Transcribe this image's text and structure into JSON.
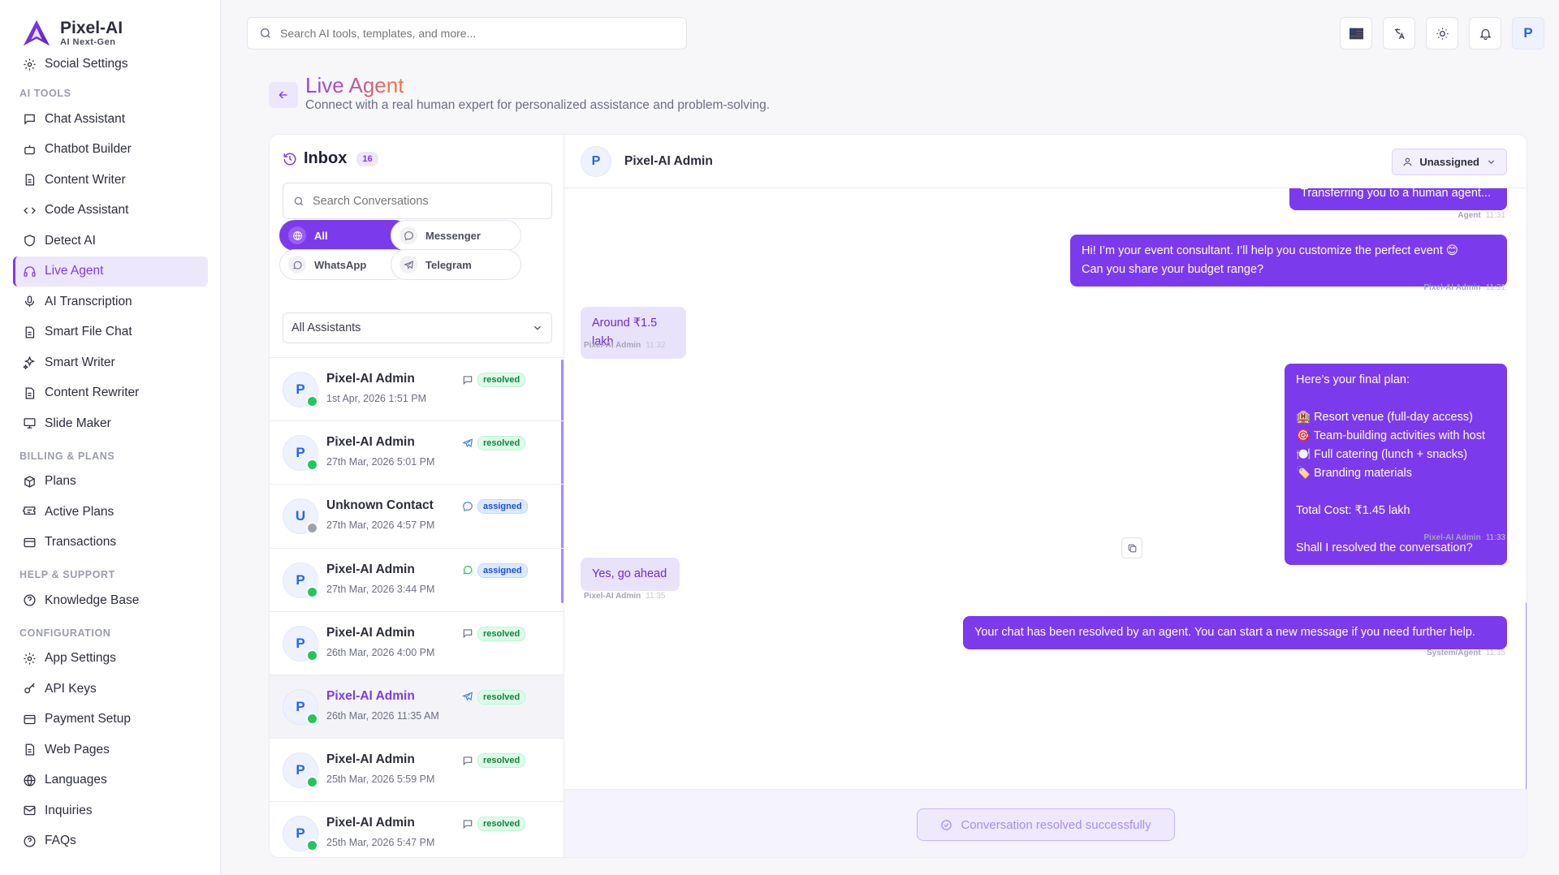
{
  "brand": {
    "name": "Pixel-AI",
    "tagline": "AI Next-Gen"
  },
  "sidebar": {
    "first_item": "Social Settings",
    "sections": [
      {
        "title": "AI TOOLS",
        "items": [
          {
            "label": "Chat Assistant",
            "icon": "chat-icon"
          },
          {
            "label": "Chatbot Builder",
            "icon": "bot-icon"
          },
          {
            "label": "Content Writer",
            "icon": "doc-icon"
          },
          {
            "label": "Code Assistant",
            "icon": "code-icon"
          },
          {
            "label": "Detect AI",
            "icon": "shield-icon"
          },
          {
            "label": "Live Agent",
            "icon": "headset-icon",
            "active": true
          },
          {
            "label": "AI Transcription",
            "icon": "mic-icon"
          },
          {
            "label": "Smart File Chat",
            "icon": "doc-icon"
          },
          {
            "label": "Smart Writer",
            "icon": "sparkle-icon"
          },
          {
            "label": "Content Rewriter",
            "icon": "doc-icon"
          },
          {
            "label": "Slide Maker",
            "icon": "presentation-icon"
          }
        ]
      },
      {
        "title": "BILLING & PLANS",
        "items": [
          {
            "label": "Plans",
            "icon": "box-icon"
          },
          {
            "label": "Active Plans",
            "icon": "ticket-icon"
          },
          {
            "label": "Transactions",
            "icon": "card-icon"
          }
        ]
      },
      {
        "title": "HELP & SUPPORT",
        "items": [
          {
            "label": "Knowledge Base",
            "icon": "help-icon"
          }
        ]
      },
      {
        "title": "CONFIGURATION",
        "items": [
          {
            "label": "App Settings",
            "icon": "gear-icon"
          },
          {
            "label": "API Keys",
            "icon": "key-icon"
          },
          {
            "label": "Payment Setup",
            "icon": "card-icon"
          },
          {
            "label": "Web Pages",
            "icon": "doc-icon"
          },
          {
            "label": "Languages",
            "icon": "globe-icon"
          },
          {
            "label": "Inquiries",
            "icon": "mail-icon"
          },
          {
            "label": "FAQs",
            "icon": "help-icon"
          }
        ]
      }
    ]
  },
  "topbar": {
    "search_placeholder": "Search AI tools, templates, and more...",
    "avatar": "P"
  },
  "header": {
    "title": "Live Agent",
    "subtitle": "Connect with a real human expert for personalized assistance and problem-solving."
  },
  "inbox": {
    "title": "Inbox",
    "count": "16",
    "search_placeholder": "Search Conversations",
    "filters": [
      {
        "label": "All",
        "icon": "globe-icon",
        "active": true
      },
      {
        "label": "Messenger",
        "icon": "messenger-icon"
      },
      {
        "label": "WhatsApp",
        "icon": "whatsapp-icon"
      },
      {
        "label": "Telegram",
        "icon": "telegram-icon"
      }
    ],
    "assistant_select": "All Assistants",
    "conversations": [
      {
        "initial": "P",
        "name": "Pixel-AI Admin",
        "time": "1st Apr, 2026  1:51 PM",
        "channel": "chat",
        "status": "resolved",
        "online": true
      },
      {
        "initial": "P",
        "name": "Pixel-AI Admin",
        "time": "27th Mar, 2026  5:01 PM",
        "channel": "telegram",
        "status": "resolved",
        "online": true
      },
      {
        "initial": "U",
        "name": "Unknown Contact",
        "time": "27th Mar, 2026  4:57 PM",
        "channel": "messenger",
        "status": "assigned",
        "online": false
      },
      {
        "initial": "P",
        "name": "Pixel-AI Admin",
        "time": "27th Mar, 2026  3:44 PM",
        "channel": "whatsapp",
        "status": "assigned",
        "online": true
      },
      {
        "initial": "P",
        "name": "Pixel-AI Admin",
        "time": "26th Mar, 2026  4:00 PM",
        "channel": "chat",
        "status": "resolved",
        "online": true
      },
      {
        "initial": "P",
        "name": "Pixel-AI Admin",
        "time": "26th Mar, 2026  11:35 AM",
        "channel": "telegram",
        "status": "resolved",
        "online": true,
        "selected": true
      },
      {
        "initial": "P",
        "name": "Pixel-AI Admin",
        "time": "25th Mar, 2026  5:59 PM",
        "channel": "chat",
        "status": "resolved",
        "online": true
      },
      {
        "initial": "P",
        "name": "Pixel-AI Admin",
        "time": "25th Mar, 2026  5:47 PM",
        "channel": "chat",
        "status": "resolved",
        "online": true
      }
    ]
  },
  "chat": {
    "contact_initial": "P",
    "contact_name": "Pixel-AI Admin",
    "assign_label": "Unassigned",
    "messages": [
      {
        "dir": "out",
        "text": "Transferring you to a human agent...",
        "sender": "Agent",
        "time": "11:31"
      },
      {
        "dir": "out",
        "text": "Hi! I’m your event consultant. I’ll help you customize the perfect event 😊\nCan you share your budget range?",
        "sender": "Pixel-AI Admin",
        "time": "11:31"
      },
      {
        "dir": "in",
        "text": "Around ₹1.5 lakh",
        "sender": "Pixel-AI Admin",
        "time": "11:32"
      },
      {
        "dir": "out",
        "text": "Here’s your final plan:\n\n🏨 Resort venue (full-day access)\n🎯 Team-building activities with host\n🍽️ Full catering (lunch + snacks)\n🏷️ Branding materials\n\nTotal Cost: ₹1.45 lakh\n\nShall I resolved the conversation?",
        "sender": "Pixel-AI Admin",
        "time": "11:33"
      },
      {
        "dir": "in",
        "text": "Yes, go ahead",
        "sender": "Pixel-AI Admin",
        "time": "11:35"
      },
      {
        "dir": "out",
        "text": "Your chat has been resolved by an agent. You can start a new message if you need further help.",
        "sender": "System/Agent",
        "time": "11:35"
      }
    ],
    "resolved_notice": "Conversation resolved successfully"
  },
  "colors": {
    "accent": "#7c3aed",
    "online": "#22c55e"
  }
}
